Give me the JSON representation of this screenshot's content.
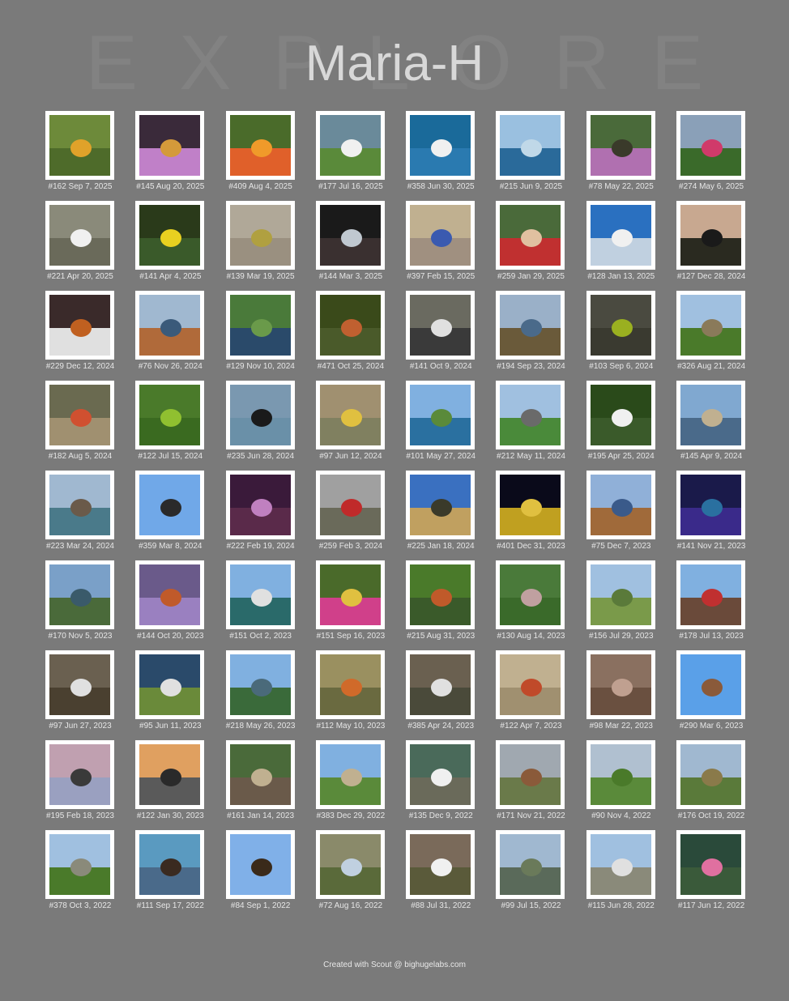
{
  "header": {
    "title": "Maria-H",
    "background_word": [
      "E",
      "X",
      "P",
      "L",
      "O",
      "R",
      "E"
    ]
  },
  "footer": {
    "credit": "Created with Scout @ bighugelabs.com"
  },
  "photos": [
    {
      "caption": "#162 Sep 7, 2025",
      "palette": [
        "#6d8a3a",
        "#4e6b2a",
        "#e0a22a"
      ]
    },
    {
      "caption": "#145 Aug 20, 2025",
      "palette": [
        "#3a2a3a",
        "#c080c8",
        "#d49a3a"
      ]
    },
    {
      "caption": "#409 Aug 4, 2025",
      "palette": [
        "#4a6b2a",
        "#e0602a",
        "#f09a2a"
      ]
    },
    {
      "caption": "#177 Jul 16, 2025",
      "palette": [
        "#6a8a9a",
        "#5a8a3a",
        "#f0f0f0"
      ]
    },
    {
      "caption": "#358 Jun 30, 2025",
      "palette": [
        "#1a6a9a",
        "#2a7ab0",
        "#f0f0f0"
      ]
    },
    {
      "caption": "#215 Jun 9, 2025",
      "palette": [
        "#9ac0e0",
        "#2a6a9a",
        "#c0d8e8"
      ]
    },
    {
      "caption": "#78 May 22, 2025",
      "palette": [
        "#4a6a3a",
        "#b070b0",
        "#3a3a2a"
      ]
    },
    {
      "caption": "#274 May 6, 2025",
      "palette": [
        "#8aa0b8",
        "#3a6a2a",
        "#d03a6a"
      ]
    },
    {
      "caption": "#221 Apr 20, 2025",
      "palette": [
        "#8a8a7a",
        "#6a6a5a",
        "#f0f0f0"
      ]
    },
    {
      "caption": "#141 Apr 4, 2025",
      "palette": [
        "#2a3a1a",
        "#3a5a2a",
        "#e8d020"
      ]
    },
    {
      "caption": "#139 Mar 19, 2025",
      "palette": [
        "#b0a898",
        "#9a9080",
        "#b0a040"
      ]
    },
    {
      "caption": "#144 Mar 3, 2025",
      "palette": [
        "#1a1a1a",
        "#3a3030",
        "#c0c8d0"
      ]
    },
    {
      "caption": "#397 Feb 15, 2025",
      "palette": [
        "#c0b090",
        "#a09080",
        "#3a5ab0"
      ]
    },
    {
      "caption": "#259 Jan 29, 2025",
      "palette": [
        "#4a6a3a",
        "#c03030",
        "#e0c0a0"
      ]
    },
    {
      "caption": "#128 Jan 13, 2025",
      "palette": [
        "#2a70c0",
        "#c0d0e0",
        "#f0f0f0"
      ]
    },
    {
      "caption": "#127 Dec 28, 2024",
      "palette": [
        "#c8a890",
        "#2a2a20",
        "#1a1a1a"
      ]
    },
    {
      "caption": "#229 Dec 12, 2024",
      "palette": [
        "#3a2a2a",
        "#e0e0e0",
        "#c06020"
      ]
    },
    {
      "caption": "#76 Nov 26, 2024",
      "palette": [
        "#a0b8d0",
        "#b06a3a",
        "#3a5a7a"
      ]
    },
    {
      "caption": "#129 Nov 10, 2024",
      "palette": [
        "#4a7a3a",
        "#2a4a6a",
        "#6a9a4a"
      ]
    },
    {
      "caption": "#471 Oct 25, 2024",
      "palette": [
        "#3a4a1a",
        "#4a5a2a",
        "#c06030"
      ]
    },
    {
      "caption": "#141 Oct 9, 2024",
      "palette": [
        "#6a6a60",
        "#3a3a3a",
        "#e0e0e0"
      ]
    },
    {
      "caption": "#194 Sep 23, 2024",
      "palette": [
        "#9ab0c8",
        "#6a5a3a",
        "#4a6a8a"
      ]
    },
    {
      "caption": "#103 Sep 6, 2024",
      "palette": [
        "#4a4a40",
        "#3a3a30",
        "#9ab020"
      ]
    },
    {
      "caption": "#326 Aug 21, 2024",
      "palette": [
        "#a0c0e0",
        "#4a7a2a",
        "#8a7a5a"
      ]
    },
    {
      "caption": "#182 Aug 5, 2024",
      "palette": [
        "#6a6a50",
        "#a09070",
        "#d05030"
      ]
    },
    {
      "caption": "#122 Jul 15, 2024",
      "palette": [
        "#4a7a2a",
        "#3a6a20",
        "#90c030"
      ]
    },
    {
      "caption": "#235 Jun 28, 2024",
      "palette": [
        "#7a98b0",
        "#6a90a8",
        "#1a1a1a"
      ]
    },
    {
      "caption": "#97 Jun 12, 2024",
      "palette": [
        "#a09070",
        "#808060",
        "#e0c040"
      ]
    },
    {
      "caption": "#101 May 27, 2024",
      "palette": [
        "#80b0e0",
        "#2a70a0",
        "#5a8a3a"
      ]
    },
    {
      "caption": "#212 May 11, 2024",
      "palette": [
        "#a0c0e0",
        "#4a8a3a",
        "#6a6a6a"
      ]
    },
    {
      "caption": "#195 Apr 25, 2024",
      "palette": [
        "#2a4a1a",
        "#3a5a2a",
        "#f0f0f0"
      ]
    },
    {
      "caption": "#145 Apr 9, 2024",
      "palette": [
        "#80a8d0",
        "#4a6a8a",
        "#c0b090"
      ]
    },
    {
      "caption": "#223 Mar 24, 2024",
      "palette": [
        "#a0b8d0",
        "#4a7a8a",
        "#6a5a4a"
      ]
    },
    {
      "caption": "#359 Mar 8, 2024",
      "palette": [
        "#70a8e8",
        "#70a8e8",
        "#2a2a2a"
      ]
    },
    {
      "caption": "#222 Feb 19, 2024",
      "palette": [
        "#3a1a3a",
        "#5a2a4a",
        "#c080c0"
      ]
    },
    {
      "caption": "#259 Feb 3, 2024",
      "palette": [
        "#a0a0a0",
        "#6a6a5a",
        "#c02a2a"
      ]
    },
    {
      "caption": "#225 Jan 18, 2024",
      "palette": [
        "#3a70c0",
        "#c0a060",
        "#3a3a2a"
      ]
    },
    {
      "caption": "#401 Dec 31, 2023",
      "palette": [
        "#0a0a1a",
        "#c0a020",
        "#e0c040"
      ]
    },
    {
      "caption": "#75 Dec 7, 2023",
      "palette": [
        "#90b0d8",
        "#a06a3a",
        "#3a5a8a"
      ]
    },
    {
      "caption": "#141 Nov 21, 2023",
      "palette": [
        "#1a1a4a",
        "#3a2a8a",
        "#2a70a0"
      ]
    },
    {
      "caption": "#170 Nov 5, 2023",
      "palette": [
        "#7aa0c8",
        "#4a6a3a",
        "#3a5a6a"
      ]
    },
    {
      "caption": "#144 Oct 20, 2023",
      "palette": [
        "#6a5a8a",
        "#9a80c0",
        "#c05a2a"
      ]
    },
    {
      "caption": "#151 Oct 2, 2023",
      "palette": [
        "#80b0e0",
        "#2a6a6a",
        "#e0e0e0"
      ]
    },
    {
      "caption": "#151 Sep 16, 2023",
      "palette": [
        "#4a6a2a",
        "#d0408a",
        "#e0c040"
      ]
    },
    {
      "caption": "#215 Aug 31, 2023",
      "palette": [
        "#4a7a2a",
        "#3a5a2a",
        "#c05a2a"
      ]
    },
    {
      "caption": "#130 Aug 14, 2023",
      "palette": [
        "#4a7a3a",
        "#3a6a2a",
        "#c0a0a0"
      ]
    },
    {
      "caption": "#156 Jul 29, 2023",
      "palette": [
        "#a0c0e0",
        "#7a9a4a",
        "#5a7a3a"
      ]
    },
    {
      "caption": "#178 Jul 13, 2023",
      "palette": [
        "#80b0e0",
        "#6a4a3a",
        "#c03030"
      ]
    },
    {
      "caption": "#97 Jun 27, 2023",
      "palette": [
        "#6a6050",
        "#4a4030",
        "#e0e0e0"
      ]
    },
    {
      "caption": "#95 Jun 11, 2023",
      "palette": [
        "#2a4a6a",
        "#6a8a3a",
        "#e0e0e0"
      ]
    },
    {
      "caption": "#218 May 26, 2023",
      "palette": [
        "#80b0e0",
        "#3a6a3a",
        "#4a6a7a"
      ]
    },
    {
      "caption": "#112 May 10, 2023",
      "palette": [
        "#9a9060",
        "#6a6a40",
        "#d06a2a"
      ]
    },
    {
      "caption": "#385 Apr 24, 2023",
      "palette": [
        "#6a6050",
        "#4a4a3a",
        "#e0e0e0"
      ]
    },
    {
      "caption": "#122 Apr 7, 2023",
      "palette": [
        "#c0b090",
        "#a09070",
        "#c04a2a"
      ]
    },
    {
      "caption": "#98 Mar 22, 2023",
      "palette": [
        "#8a7060",
        "#6a5040",
        "#c0a090"
      ]
    },
    {
      "caption": "#290 Mar 6, 2023",
      "palette": [
        "#5aa0e8",
        "#5aa0e8",
        "#8a5a3a"
      ]
    },
    {
      "caption": "#195 Feb 18, 2023",
      "palette": [
        "#c0a0b0",
        "#9aa0c0",
        "#3a3a3a"
      ]
    },
    {
      "caption": "#122 Jan 30, 2023",
      "palette": [
        "#e0a060",
        "#5a5a5a",
        "#2a2a2a"
      ]
    },
    {
      "caption": "#161 Jan 14, 2023",
      "palette": [
        "#4a6a3a",
        "#6a5a4a",
        "#c0b090"
      ]
    },
    {
      "caption": "#383 Dec 29, 2022",
      "palette": [
        "#80b0e0",
        "#5a8a3a",
        "#c0b090"
      ]
    },
    {
      "caption": "#135 Dec 9, 2022",
      "palette": [
        "#4a6a5a",
        "#6a6a5a",
        "#f0f0f0"
      ]
    },
    {
      "caption": "#171 Nov 21, 2022",
      "palette": [
        "#a0a8b0",
        "#6a7a4a",
        "#8a5a3a"
      ]
    },
    {
      "caption": "#90 Nov 4, 2022",
      "palette": [
        "#b0c0d0",
        "#5a8a3a",
        "#4a7a2a"
      ]
    },
    {
      "caption": "#176 Oct 19, 2022",
      "palette": [
        "#a0b8d0",
        "#5a7a3a",
        "#8a7a4a"
      ]
    },
    {
      "caption": "#378 Oct 3, 2022",
      "palette": [
        "#a0c0e0",
        "#4a7a2a",
        "#8a8a7a"
      ]
    },
    {
      "caption": "#111 Sep 17, 2022",
      "palette": [
        "#5a9ac0",
        "#4a6a8a",
        "#3a2a20"
      ]
    },
    {
      "caption": "#84 Sep 1, 2022",
      "palette": [
        "#80b0e8",
        "#80b0e8",
        "#3a2a1a"
      ]
    },
    {
      "caption": "#72 Aug 16, 2022",
      "palette": [
        "#8a8a6a",
        "#5a6a3a",
        "#c0d0e0"
      ]
    },
    {
      "caption": "#88 Jul 31, 2022",
      "palette": [
        "#7a6a5a",
        "#5a5a3a",
        "#f0f0f0"
      ]
    },
    {
      "caption": "#99 Jul 15, 2022",
      "palette": [
        "#a0b8d0",
        "#5a6a5a",
        "#6a7a5a"
      ]
    },
    {
      "caption": "#115 Jun 28, 2022",
      "palette": [
        "#a0c0e0",
        "#8a8a7a",
        "#e0e0e0"
      ]
    },
    {
      "caption": "#117 Jun 12, 2022",
      "palette": [
        "#2a4a3a",
        "#3a5a3a",
        "#e070a0"
      ]
    }
  ]
}
